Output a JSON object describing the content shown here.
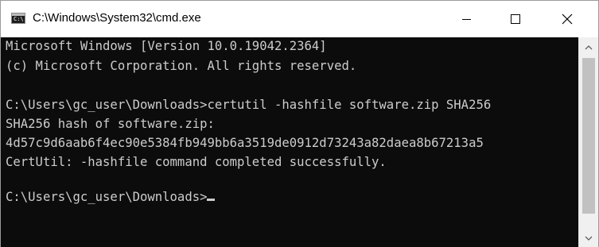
{
  "window": {
    "title": "C:\\Windows\\System32\\cmd.exe",
    "icon": "cmd-icon",
    "controls": [
      "minimize-icon",
      "maximize-icon",
      "close-icon"
    ]
  },
  "console": {
    "lines": [
      "Microsoft Windows [Version 10.0.19042.2364]",
      "(c) Microsoft Corporation. All rights reserved.",
      "",
      "C:\\Users\\gc_user\\Downloads>certutil -hashfile software.zip SHA256",
      "SHA256 hash of software.zip:",
      "4d57c9d6aab6f4ec90e5384fb949bb6a3519de0912d73243a82daea8b67213a5",
      "CertUtil: -hashfile command completed successfully.",
      "",
      "C:\\Users\\gc_user\\Downloads>"
    ],
    "text_color": "#cccccc",
    "background_color": "#0c0c0c"
  },
  "scrollbar": {
    "thumb_color": "#c1c1c1",
    "track_color": "#f0f0f0"
  }
}
